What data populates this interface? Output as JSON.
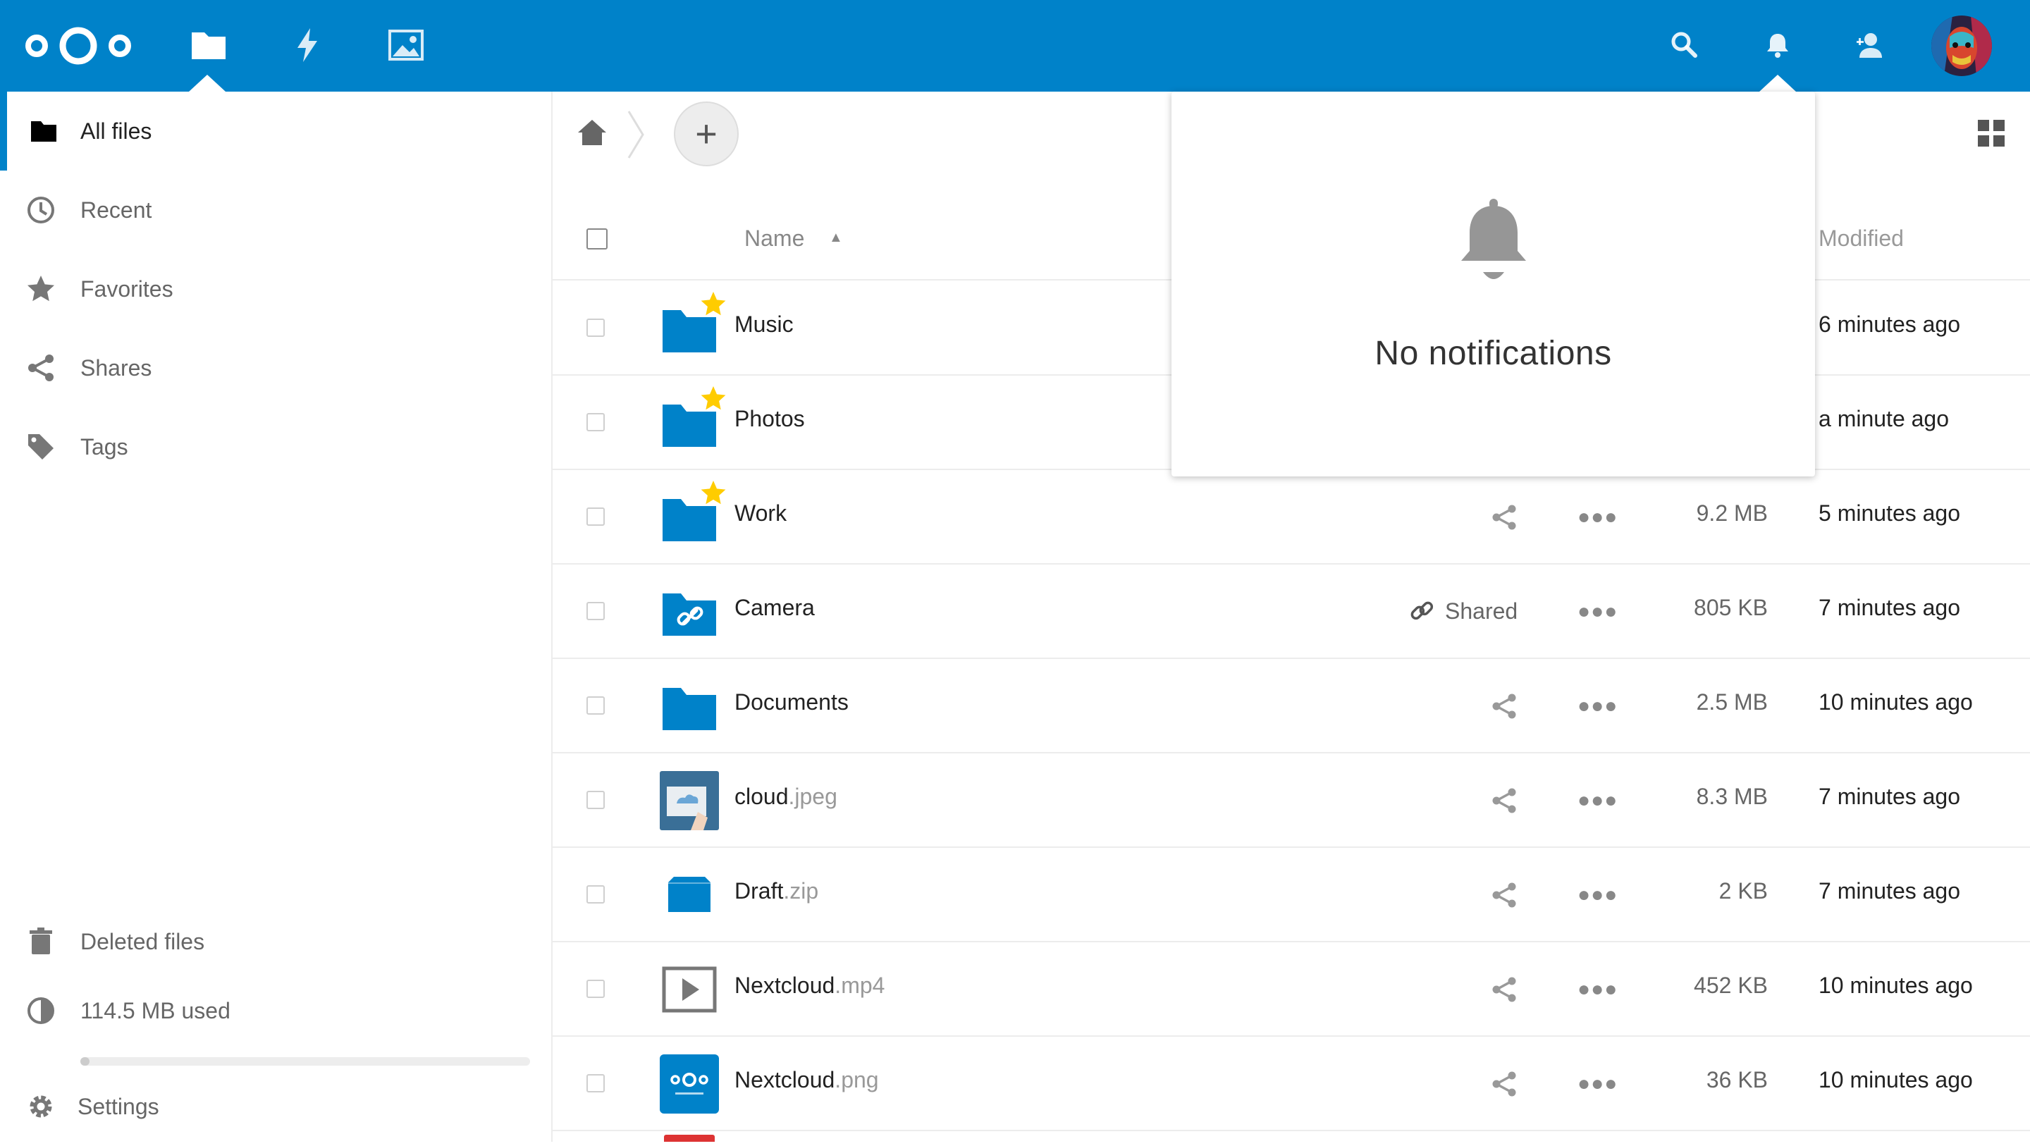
{
  "header": {
    "apps": [
      {
        "name": "files-app-icon"
      },
      {
        "name": "activity-app-icon"
      },
      {
        "name": "gallery-app-icon"
      }
    ]
  },
  "sidebar": {
    "items": [
      {
        "label": "All files",
        "icon": "folder-icon"
      },
      {
        "label": "Recent",
        "icon": "clock-icon"
      },
      {
        "label": "Favorites",
        "icon": "star-icon"
      },
      {
        "label": "Shares",
        "icon": "share-icon"
      },
      {
        "label": "Tags",
        "icon": "tag-icon"
      }
    ],
    "deleted_files": "Deleted files",
    "quota_text": "114.5 MB used",
    "quota_fill": 0.02,
    "settings": "Settings"
  },
  "table": {
    "header_name": "Name",
    "header_modified": "Modified",
    "rows": [
      {
        "name": "Music",
        "ext": "",
        "size": "",
        "modified": "6 minutes ago",
        "type": "folder",
        "favorite": true
      },
      {
        "name": "Photos",
        "ext": "",
        "size": "",
        "modified": "a minute ago",
        "type": "folder",
        "favorite": true
      },
      {
        "name": "Work",
        "ext": "",
        "size": "9.2 MB",
        "modified": "5 minutes ago",
        "type": "folder",
        "favorite": true
      },
      {
        "name": "Camera",
        "ext": "",
        "size": "805 KB",
        "modified": "7 minutes ago",
        "type": "folder-shared",
        "shared_label": "Shared"
      },
      {
        "name": "Documents",
        "ext": "",
        "size": "2.5 MB",
        "modified": "10 minutes ago",
        "type": "folder"
      },
      {
        "name": "cloud",
        "ext": ".jpeg",
        "size": "8.3 MB",
        "modified": "7 minutes ago",
        "type": "image"
      },
      {
        "name": "Draft",
        "ext": ".zip",
        "size": "2 KB",
        "modified": "7 minutes ago",
        "type": "archive"
      },
      {
        "name": "Nextcloud",
        "ext": ".mp4",
        "size": "452 KB",
        "modified": "10 minutes ago",
        "type": "video"
      },
      {
        "name": "Nextcloud",
        "ext": ".png",
        "size": "36 KB",
        "modified": "10 minutes ago",
        "type": "png"
      }
    ]
  },
  "notifications": {
    "empty_text": "No notifications"
  },
  "colors": {
    "brand": "#0082c9",
    "star": "#fc0"
  }
}
